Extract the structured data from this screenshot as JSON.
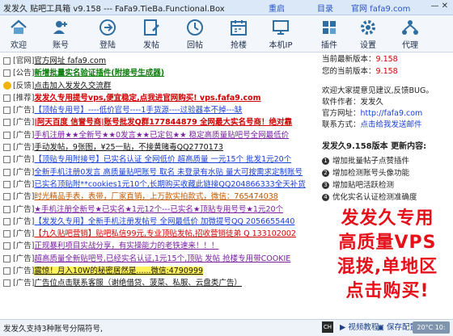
{
  "titlebar": {
    "app_name": "发发久 贴吧工具箱",
    "version": "v9.158",
    "subtitle": "--- FaFa9.TieBa.Functional.Box",
    "links": [
      "重启",
      "目录",
      "官网 fafa9.com"
    ],
    "window_controls": "— ✕"
  },
  "toolbar": {
    "items": [
      {
        "label": "欢迎",
        "icon": "home-icon"
      },
      {
        "label": "账号",
        "icon": "user-add-icon"
      },
      {
        "label": "登陆",
        "icon": "login-icon"
      },
      {
        "label": "发帖",
        "icon": "post-icon"
      },
      {
        "label": "回帖",
        "icon": "reply-icon"
      },
      {
        "label": "抢楼",
        "icon": "grab-floor-icon"
      },
      {
        "label": "本机IP",
        "icon": "ip-icon"
      },
      {
        "label": "插件",
        "icon": "plugin-icon"
      },
      {
        "label": "设置",
        "icon": "settings-icon"
      },
      {
        "label": "代理",
        "icon": "proxy-icon"
      }
    ]
  },
  "list": [
    {
      "tag": "[官网]",
      "text": "官方网址  fafa9.com",
      "color": "black",
      "bold": false,
      "pic": false
    },
    {
      "tag": "[公告]",
      "text": "新增批量实名验证插件(附接号生成器)",
      "color": "green",
      "bold": true,
      "pic": false
    },
    {
      "tag": "[反馈]",
      "text": "点击加入发发久交流群",
      "color": "black",
      "bold": false,
      "pic": true
    },
    {
      "tag": "[推荐]",
      "text": "发发久专用提号vps,便宜稳定,点我进官网购买! vps.fafa9.com",
      "color": "red",
      "bold": true,
      "pic": false
    },
    {
      "tag": "[广告]",
      "text": "【顶帖专用号】----低价官号----1手货源----过验器本不掉---缺",
      "color": "blue",
      "bold": false,
      "pic": false
    },
    {
      "tag": "[广告]",
      "text": "|阿天百度 信誉号商|账号批发Q群177844879 全网最大实名号商！绝对靠",
      "color": "red",
      "bold": true,
      "pic": false
    },
    {
      "tag": "[广告]",
      "text": "手机注册★★全新号★★0发言★★已定包★★ 稳定高质量贴吧号全网最低价",
      "color": "purple",
      "bold": false,
      "pic": false
    },
    {
      "tag": "[广告]",
      "text": "手动发帖，9张图，¥25一贴，不接黄赌毒QQ2770173",
      "color": "black",
      "bold": false,
      "pic": false
    },
    {
      "tag": "[广告]",
      "text": "【顶贴专用附接号】已实名认证 全网低价 超高质量 一元15个 批发1元20个",
      "color": "blue",
      "bold": false,
      "pic": false
    },
    {
      "tag": "[广告]",
      "text": "全新手机注册0发言 高质量贴吧账号 取名 未登录有水贴 量大可按需求定制账号",
      "color": "blue",
      "bold": false,
      "pic": false
    },
    {
      "tag": "[广告]",
      "text": "已实名顶贴附**cookies1元10个,长期购买收藏此链接QQ204866333全天补货",
      "color": "blue",
      "bold": false,
      "pic": false
    },
    {
      "tag": "[广告]",
      "text": "时光精品手表，表带，厂家直销，上万款实拍款式，微信：765474038",
      "color": "orange",
      "bold": false,
      "pic": false
    },
    {
      "tag": "[广告]",
      "text": "★手机注册全新号★已实名★1元12个---已实名★顶贴专用号号★1元20个",
      "color": "purple",
      "bold": false,
      "pic": false
    },
    {
      "tag": "[广告]",
      "text": "【发发久专用】全新手机注册发帖号 全网最低价 加微提号QQ 2056655440",
      "color": "blue",
      "bold": false,
      "pic": false
    },
    {
      "tag": "[广告]",
      "text": "【九久贴吧营销】贴吧私信99元,专业顶贴发帖,招收营销徒弟 Q 133102002",
      "color": "red",
      "bold": false,
      "pic": false
    },
    {
      "tag": "[广告]",
      "text": "正规暴利项目实战分享，有实操能力的老铁速来！！！",
      "color": "purple",
      "bold": false,
      "pic": false
    },
    {
      "tag": "[广告]",
      "text": "超高质量全新贴吧号,已经实名认证,1元15个,顶贴 发帖 抢楼专用带COOKIE",
      "color": "purple",
      "bold": false,
      "pic": false
    },
    {
      "tag": "[广告]",
      "text": "震惊！月入10W的秘密居然是......微信:4790999",
      "color": "black",
      "bold": false,
      "pic": false,
      "highlight": true
    },
    {
      "tag": "[广告]",
      "text": "广告位点击联系客服（谢绝借贷、菠菜、私服、云盘类广告）",
      "color": "black",
      "bold": false,
      "pic": false
    }
  ],
  "info": {
    "latest_label": "当前最新版本：",
    "latest_value": "9.158",
    "current_label": "您的当前版本：",
    "current_value": "9.158",
    "note": "欢迎大家提意见建议,反馈BUG。",
    "author_label": "软件作者：发发久",
    "site_label": "官方网址：",
    "site_value": "http://fafa9.com",
    "contact_label": "联系方式：",
    "contact_value": "点击给我发送邮件"
  },
  "features": {
    "title": "发发久9.158版本  更新内容:",
    "items": [
      "增加批量帖子点赞插件",
      "增加检测账号头像功能",
      "增加贴吧活跃检测",
      "优化实名认证检测准确度"
    ]
  },
  "promo": {
    "lines": [
      "发发久专用",
      "高质量VPS",
      "混拨,单地区",
      "点击购买!"
    ]
  },
  "statusbar": {
    "text": "发发久支持3种账号分隔符号,",
    "ime": "CH",
    "video_tutorial": "视频教程",
    "save_config": "保存配置",
    "speed": "20°C 10:"
  }
}
